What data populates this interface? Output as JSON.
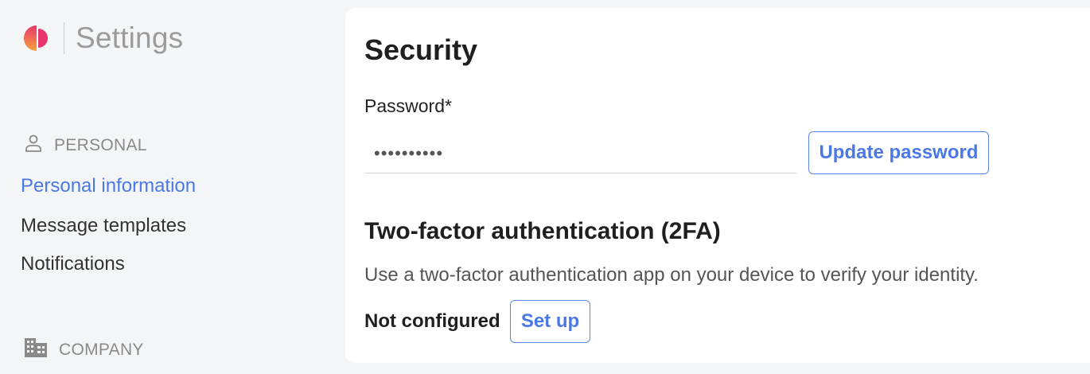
{
  "app": {
    "title": "Settings",
    "logo_icon": "brand-logo-icon"
  },
  "colors": {
    "accent": "#4a78e6",
    "background": "#f4f5f7",
    "card": "#ffffff"
  },
  "sidebar": {
    "sections": [
      {
        "label": "PERSONAL",
        "icon": "user-icon",
        "items": [
          {
            "label": "Personal information",
            "active": true
          },
          {
            "label": "Message templates",
            "active": false
          },
          {
            "label": "Notifications",
            "active": false
          }
        ]
      },
      {
        "label": "COMPANY",
        "icon": "building-icon",
        "items": []
      }
    ]
  },
  "main": {
    "title": "Security",
    "password": {
      "label": "Password*",
      "value": "••••••••••",
      "button_label": "Update password"
    },
    "two_factor": {
      "title": "Two-factor authentication (2FA)",
      "description": "Use a two-factor authentication app on your device to verify your identity.",
      "status": "Not configured",
      "button_label": "Set up"
    }
  }
}
